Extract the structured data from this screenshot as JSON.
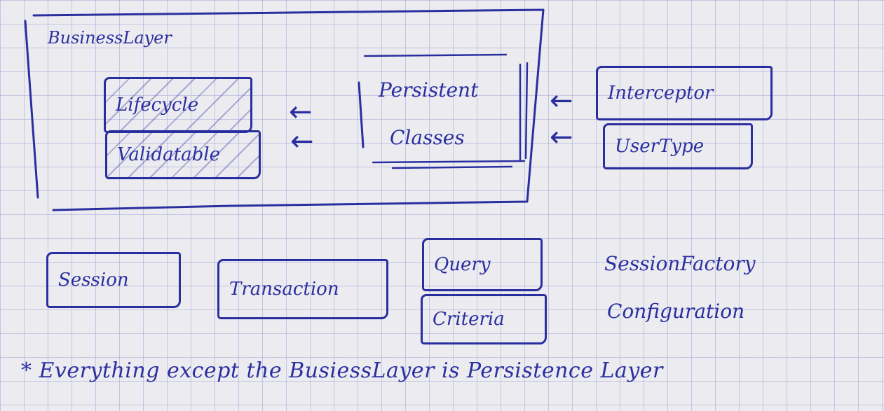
{
  "business_layer": {
    "title": "BusinessLayer"
  },
  "business_interfaces": [
    {
      "label": "Lifecycle"
    },
    {
      "label": "Validatable"
    }
  ],
  "persistent_classes": {
    "line1": "Persistent",
    "line2": "Classes"
  },
  "extension_interfaces": [
    {
      "label": "Interceptor"
    },
    {
      "label": "UserType"
    }
  ],
  "core_interfaces": [
    {
      "label": "Session"
    },
    {
      "label": "Transaction"
    },
    {
      "label": "Query"
    },
    {
      "label": "Criteria"
    }
  ],
  "classes": [
    {
      "label": "SessionFactory"
    },
    {
      "label": "Configuration"
    }
  ],
  "footnote": "* Everything except the BusiessLayer is Persistence Layer",
  "colors": {
    "ink": "#2a2fa0",
    "paper": "#ecebef",
    "grid": "#8c96d2"
  },
  "icons": [
    "arrow-left-icon"
  ]
}
